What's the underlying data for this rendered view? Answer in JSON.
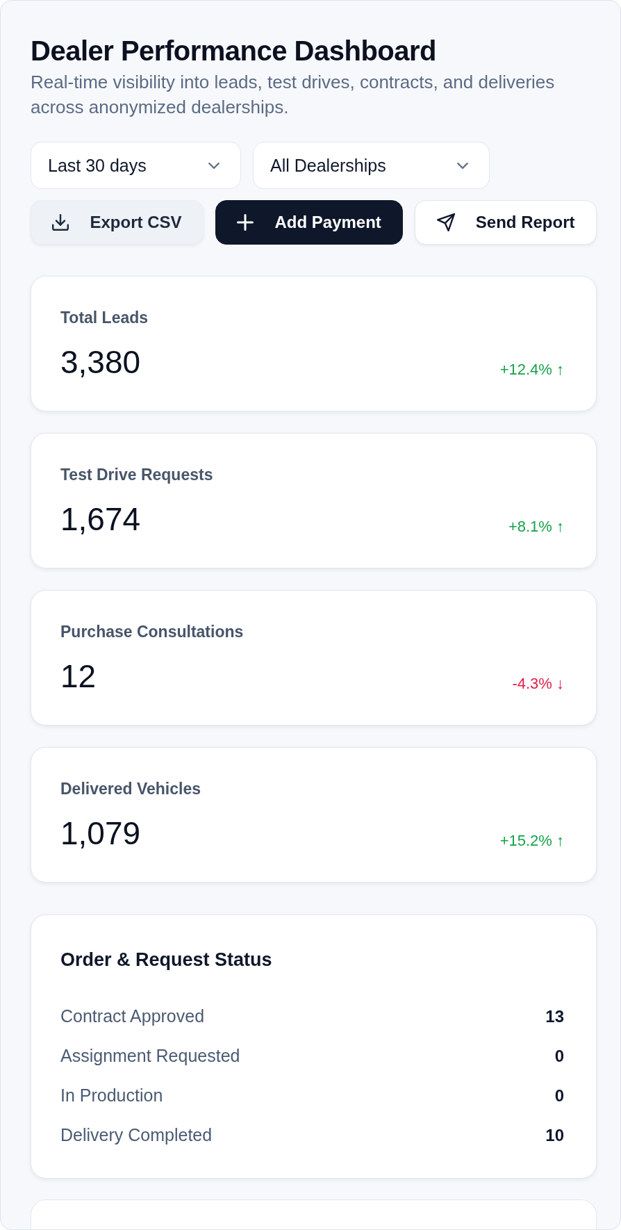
{
  "header": {
    "title": "Dealer Performance Dashboard",
    "subtitle": "Real-time visibility into leads, test drives, contracts, and deliveries across anonymized dealerships."
  },
  "filters": [
    {
      "value": "Last 30 days"
    },
    {
      "value": "All Dealerships"
    }
  ],
  "actions": [
    {
      "label": "Export CSV"
    },
    {
      "label": "Add Payment"
    },
    {
      "label": "Send Report"
    }
  ],
  "kpis": [
    {
      "label": "Total Leads",
      "value": "3,380",
      "change": "+12.4% ↑",
      "color": "#16a34a"
    },
    {
      "label": "Test Drive Requests",
      "value": "1,674",
      "change": "+8.1% ↑",
      "color": "#16a34a"
    },
    {
      "label": "Purchase Consultations",
      "value": "12",
      "change": "-4.3% ↓",
      "color": "#e11d48"
    },
    {
      "label": "Delivered Vehicles",
      "value": "1,079",
      "change": "+15.2% ↑",
      "color": "#16a34a"
    }
  ],
  "status_panel": {
    "title": "Order & Request Status",
    "rows": [
      {
        "label": "Contract Approved",
        "count": "13"
      },
      {
        "label": "Assignment Requested",
        "count": "0"
      },
      {
        "label": "In Production",
        "count": "0"
      },
      {
        "label": "Delivery Completed",
        "count": "10"
      }
    ]
  }
}
